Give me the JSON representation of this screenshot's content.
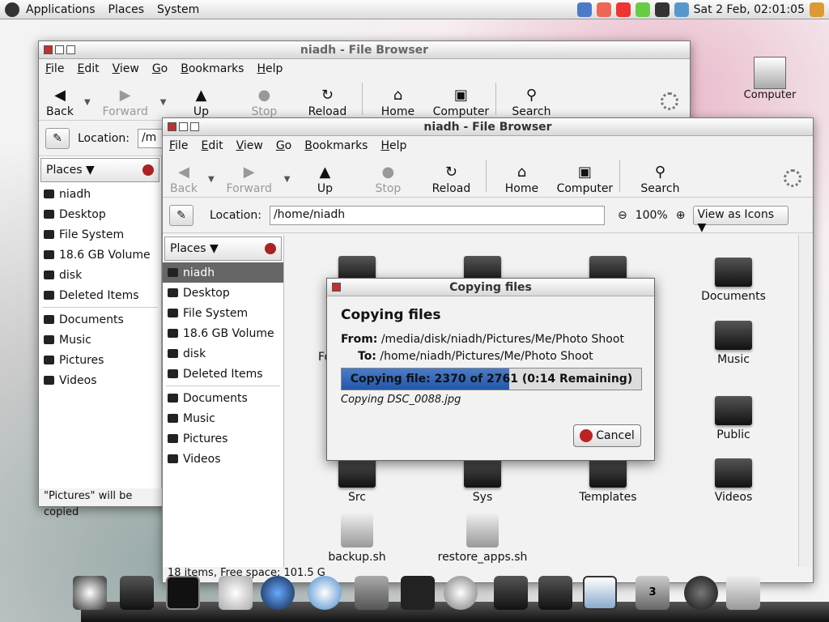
{
  "panel": {
    "menus": [
      "Applications",
      "Places",
      "System"
    ],
    "clock": "Sat  2 Feb, 02:01:05"
  },
  "desktop": {
    "computer_label": "Computer"
  },
  "back_window": {
    "title": "niadh - File Browser",
    "menus": [
      "File",
      "Edit",
      "View",
      "Go",
      "Bookmarks",
      "Help"
    ],
    "tools": [
      "Back",
      "Forward",
      "Up",
      "Stop",
      "Reload",
      "Home",
      "Computer",
      "Search"
    ],
    "location_label": "Location:",
    "location_value": "/m",
    "places_header": "Places",
    "places": [
      "niadh",
      "Desktop",
      "File System",
      "18.6 GB Volume",
      "disk",
      "Deleted Items"
    ],
    "bookmarks": [
      "Documents",
      "Music",
      "Pictures",
      "Videos"
    ],
    "status": "\"Pictures\" will be copied"
  },
  "front_window": {
    "title": "niadh - File Browser",
    "menus": [
      "File",
      "Edit",
      "View",
      "Go",
      "Bookmarks",
      "Help"
    ],
    "tools": [
      "Back",
      "Forward",
      "Up",
      "Stop",
      "Reload",
      "Home",
      "Computer",
      "Search"
    ],
    "location_label": "Location:",
    "location_value": "/home/niadh",
    "zoom": "100%",
    "view_mode": "View as Icons",
    "places_header": "Places",
    "places": [
      "niadh",
      "Desktop",
      "File System",
      "18.6 GB Volume",
      "disk",
      "Deleted Items"
    ],
    "bookmarks": [
      "Documents",
      "Music",
      "Pictures",
      "Videos"
    ],
    "items": [
      "Documents",
      "Music",
      "Public",
      "Src",
      "Sys",
      "Templates",
      "Videos",
      "backup.sh",
      "restore_apps.sh"
    ],
    "partial_label": "Fo",
    "status": "18 items, Free space: 101.5 GB"
  },
  "dialog": {
    "title": "Copying files",
    "heading": "Copying files",
    "from_label": "From:",
    "from_value": "/media/disk/niadh/Pictures/Me/Photo Shoot",
    "to_label": "To:",
    "to_value": "/home/niadh/Pictures/Me/Photo Shoot",
    "progress_text": "Copying file: 2370 of 2761 (0:14 Remaining)",
    "progress_fraction": 0.56,
    "current_file": "Copying  DSC_0088.jpg",
    "cancel_label": "Cancel"
  },
  "dock": {
    "badge": "3"
  }
}
